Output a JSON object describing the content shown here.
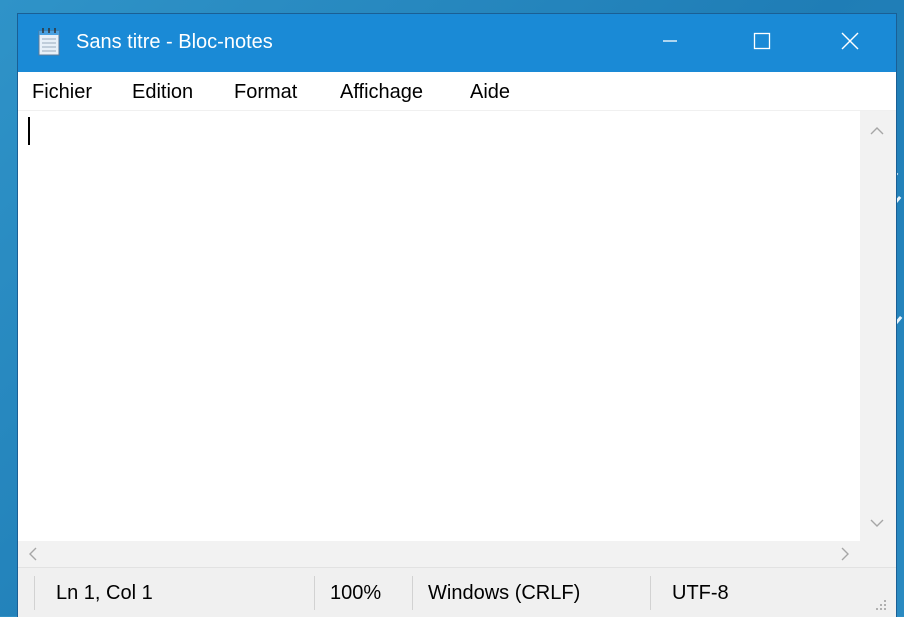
{
  "window": {
    "title": "Sans titre - Bloc-notes"
  },
  "icons": {
    "app": "notepad-icon",
    "minimize": "minimize-icon",
    "maximize": "maximize-icon",
    "close": "close-icon"
  },
  "menu": {
    "items": [
      {
        "label": "Fichier"
      },
      {
        "label": "Edition"
      },
      {
        "label": "Format"
      },
      {
        "label": "Affichage"
      },
      {
        "label": "Aide"
      }
    ]
  },
  "editor": {
    "text": ""
  },
  "status": {
    "position": "Ln 1, Col 1",
    "zoom": "100%",
    "line_ending": "Windows (CRLF)",
    "encoding": "UTF-8"
  },
  "colors": {
    "titlebar": "#1a8ad6",
    "desktop": "#2f8fc4"
  }
}
